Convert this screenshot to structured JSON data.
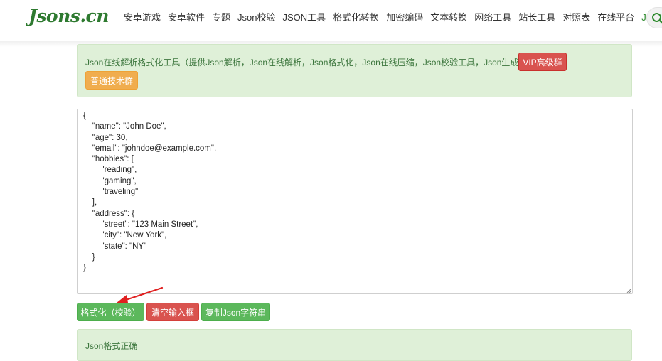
{
  "header": {
    "logo": "Jsons.cn",
    "nav": [
      {
        "label": "安卓游戏"
      },
      {
        "label": "安卓软件"
      },
      {
        "label": "专题"
      },
      {
        "label": "Json校验"
      },
      {
        "label": "JSON工具"
      },
      {
        "label": "格式化转换"
      },
      {
        "label": "加密编码"
      },
      {
        "label": "文本转换"
      },
      {
        "label": "网络工具"
      },
      {
        "label": "站长工具"
      },
      {
        "label": "对照表"
      },
      {
        "label": "在线平台"
      },
      {
        "label": "JSON教程"
      }
    ],
    "active_nav": "JSON教程",
    "search_icon": "search-icon"
  },
  "info": {
    "text": "Json在线解析格式化工具（提供Json解析，Json在线解析，Json格式化，Json在线压缩，Json校验工具，Json生成C#实体类）",
    "vip_button": "VIP高级群",
    "group_button": "普通技术群"
  },
  "editor": {
    "content": "{\n    \"name\": \"John Doe\",\n    \"age\": 30,\n    \"email\": \"johndoe@example.com\",\n    \"hobbies\": [\n        \"reading\",\n        \"gaming\",\n        \"traveling\"\n    ],\n    \"address\": {\n        \"street\": \"123 Main Street\",\n        \"city\": \"New York\",\n        \"state\": \"NY\"\n    }\n}"
  },
  "actions": {
    "format": "格式化（校验）",
    "clear": "清空输入框",
    "copy": "复制Json字符串"
  },
  "result": {
    "text": "Json格式正确"
  },
  "colors": {
    "brand_green": "#2e7a30",
    "success": "#5cb85c",
    "danger": "#d9534f",
    "warning": "#f0ad4e",
    "alert_bg": "#dff0d8",
    "arrow": "#e02020"
  }
}
